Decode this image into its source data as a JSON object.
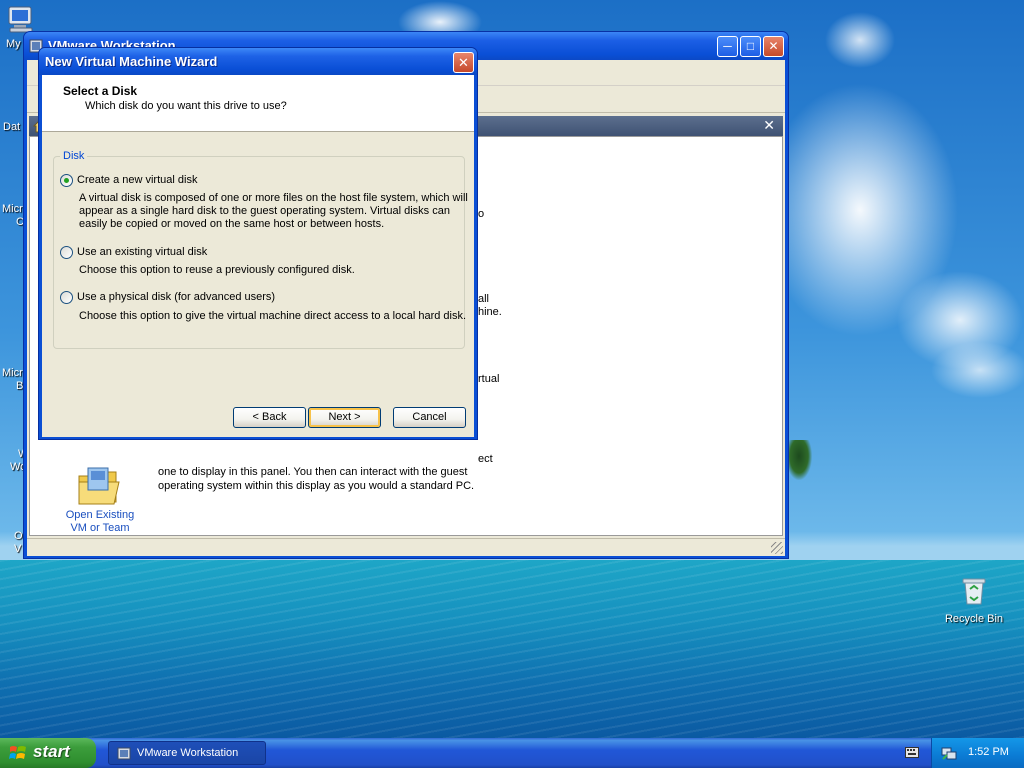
{
  "desktop": {
    "icons": {
      "my_computer": "My",
      "recycle_bin": "Recycle Bin"
    },
    "partial_labels": [
      "Dat",
      "Micro",
      "C",
      "Micro",
      "B",
      "W",
      "Wo",
      "O",
      "V"
    ]
  },
  "vmware": {
    "title": "VMware Workstation",
    "home_partial": [
      "o",
      "all",
      "hine.",
      "rtual",
      "ect"
    ],
    "home_text_line1": "one to display in this panel. You then can interact with the guest",
    "home_text_line2": "operating system within this display as you would a standard PC.",
    "open_existing_line1": "Open Existing",
    "open_existing_line2": "VM or Team"
  },
  "wizard": {
    "title": "New Virtual Machine Wizard",
    "heading": "Select a Disk",
    "subheading": "Which disk do you want this drive to use?",
    "group_label": "Disk",
    "options": [
      {
        "label": "Create a new virtual disk",
        "selected": true,
        "desc": [
          "A virtual disk is composed of one or more files on the host file system, which will",
          "appear as a single hard disk to the guest operating system. Virtual disks can",
          "easily be copied or moved on the same host or between hosts."
        ]
      },
      {
        "label": "Use an existing virtual disk",
        "selected": false,
        "desc": [
          "Choose this option to reuse a previously configured disk."
        ]
      },
      {
        "label": "Use a physical disk (for advanced users)",
        "selected": false,
        "desc": [
          "Choose this option to give the virtual machine direct access to a local hard disk."
        ]
      }
    ],
    "buttons": {
      "back": "< Back",
      "next": "Next >",
      "cancel": "Cancel"
    }
  },
  "taskbar": {
    "start": "start",
    "task_vmware": "VMware Workstation",
    "clock": "1:52 PM"
  },
  "colors": {
    "xp_blue": "#0a4fd6",
    "start_green": "#3c9d3c",
    "group_label_blue": "#0046d5",
    "radio_dot_green": "#21a121"
  }
}
